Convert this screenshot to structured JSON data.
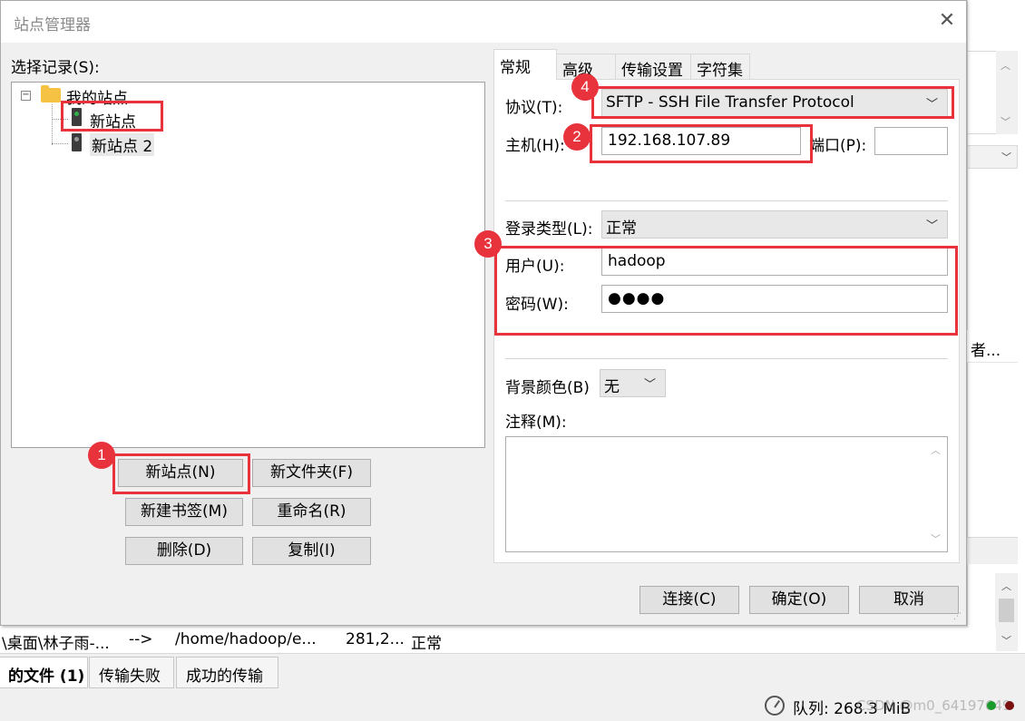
{
  "dialog": {
    "title": "站点管理器",
    "select_entry_label": "选择记录(S):",
    "tree": {
      "root": "我的站点",
      "items": [
        "新站点",
        "新站点 2"
      ]
    },
    "buttons": {
      "new_site": "新站点(N)",
      "new_folder": "新文件夹(F)",
      "new_bookmark": "新建书签(M)",
      "rename": "重命名(R)",
      "delete": "删除(D)",
      "copy": "复制(I)",
      "connect": "连接(C)",
      "ok": "确定(O)",
      "cancel": "取消"
    },
    "tabs": [
      "常规",
      "高级",
      "传输设置",
      "字符集"
    ],
    "general": {
      "protocol_label": "协议(T):",
      "protocol_value": "SFTP - SSH File Transfer Protocol",
      "host_label": "主机(H):",
      "host_value": "192.168.107.89",
      "port_label": "端口(P):",
      "port_value": "",
      "logon_type_label": "登录类型(L):",
      "logon_type_value": "正常",
      "user_label": "用户(U):",
      "user_value": "hadoop",
      "password_label": "密码(W):",
      "password_value": "●●●●",
      "bg_color_label": "背景颜色(B)",
      "bg_color_value": "无",
      "comments_label": "注释(M):"
    },
    "annotations": [
      "1",
      "2",
      "3",
      "4"
    ],
    "highlight_color": "#e8323c"
  },
  "background": {
    "column_header": "者...",
    "queue_row": {
      "local": "\\桌面\\林子雨-...",
      "direction": "-->",
      "remote": "/home/hadoop/e...",
      "size": "281,2...",
      "priority": "正常"
    },
    "bottom_tabs": [
      "的文件 (1)",
      "传输失败",
      "成功的传输"
    ],
    "status": {
      "queue": "队列: 268.3 MiB",
      "watermark": "CSDN @m0_64197649"
    }
  }
}
